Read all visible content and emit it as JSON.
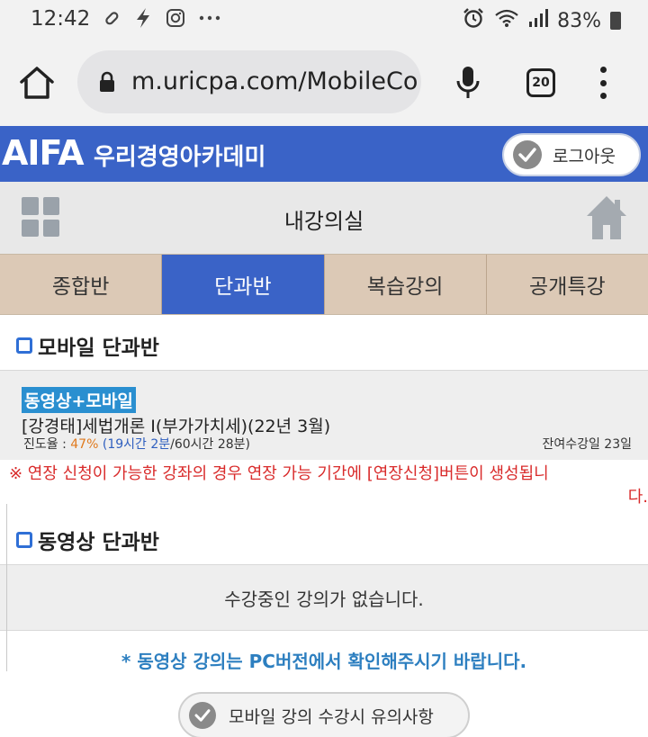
{
  "status_bar": {
    "time": "12:42",
    "battery": "83%",
    "left_icons": [
      "pin-icon",
      "bolt-icon",
      "instagram-icon",
      "more-icon"
    ],
    "right_icons": [
      "alarm-icon",
      "wifi-icon",
      "signal-icon",
      "battery-icon"
    ]
  },
  "browser": {
    "url": "m.uricpa.com/MobileCo",
    "tab_count": "20"
  },
  "site": {
    "logo_main": "AIFA",
    "logo_sub": "우리경영아카데미",
    "logout_label": "로그아웃"
  },
  "title_bar": {
    "title": "내강의실"
  },
  "tabs": [
    {
      "label": "종합반",
      "active": false
    },
    {
      "label": "단과반",
      "active": true
    },
    {
      "label": "복습강의",
      "active": false
    },
    {
      "label": "공개특강",
      "active": false
    }
  ],
  "mobile_section": {
    "heading": "모바일 단과반",
    "course": {
      "badge": "동영상+모바일",
      "title": "[강경태]세법개론 I(부가가치세)(22년 3월)",
      "progress_label": "진도율 :",
      "progress_pct": "47%",
      "progress_open": "(",
      "time_done": "19시간 2분",
      "time_total": "/60시간 28분)",
      "remaining": "잔여수강일 23일"
    }
  },
  "notice": {
    "line1": "※ 연장 신청이 가능한 강좌의 경우 연장 가능 기간에 [연장신청]버튼이 생성됩니",
    "line2": "다."
  },
  "video_section": {
    "heading": "동영상 단과반",
    "empty_message": "수강중인 강의가 없습니다."
  },
  "pc_note": "* 동영상 강의는 PC버전에서 확인해주시기 바랍니다.",
  "caution_button": "모바일 강의 수강시 유의사항"
}
